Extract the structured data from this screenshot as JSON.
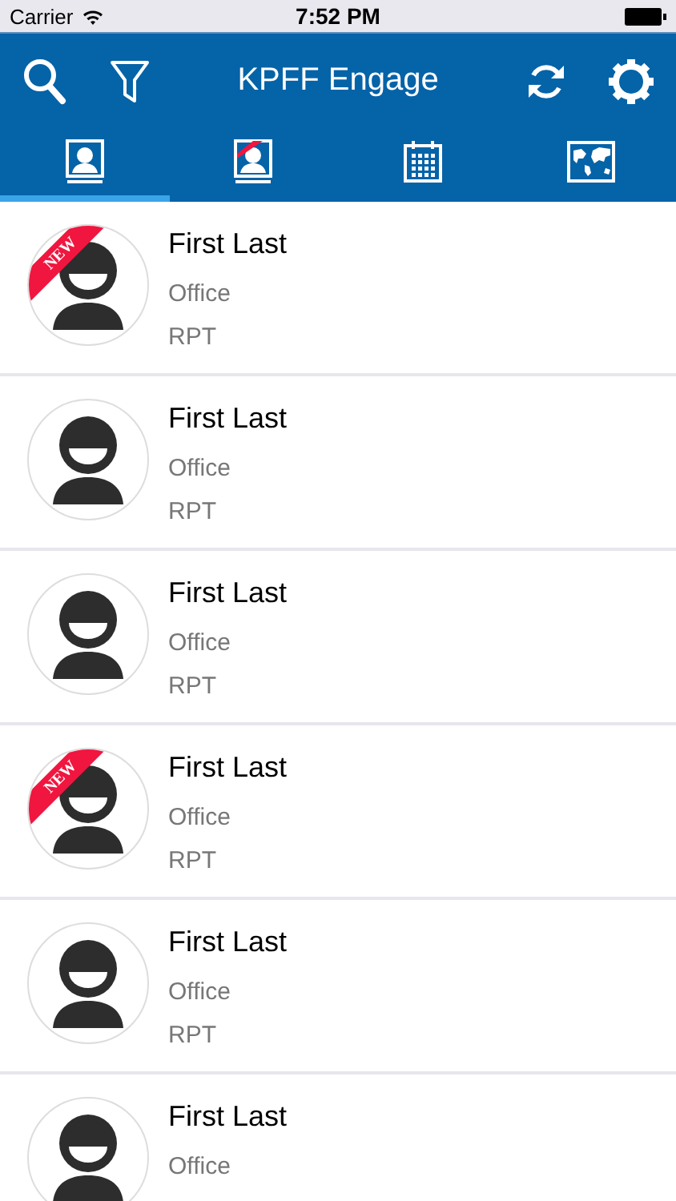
{
  "status_bar": {
    "carrier": "Carrier",
    "time": "7:52 PM"
  },
  "header": {
    "title": "KPFF Engage"
  },
  "tabs": [
    {
      "kind": "contacts",
      "selected": true
    },
    {
      "kind": "new-contacts",
      "selected": false
    },
    {
      "kind": "calendar",
      "selected": false
    },
    {
      "kind": "map",
      "selected": false
    }
  ],
  "contacts": [
    {
      "name": "First Last",
      "office": "Office",
      "role": "RPT",
      "badge": "NEW"
    },
    {
      "name": "First Last",
      "office": "Office",
      "role": "RPT"
    },
    {
      "name": "First Last",
      "office": "Office",
      "role": "RPT"
    },
    {
      "name": "First Last",
      "office": "Office",
      "role": "RPT",
      "badge": "NEW"
    },
    {
      "name": "First Last",
      "office": "Office",
      "role": "RPT"
    },
    {
      "name": "First Last",
      "office": "Office"
    }
  ]
}
